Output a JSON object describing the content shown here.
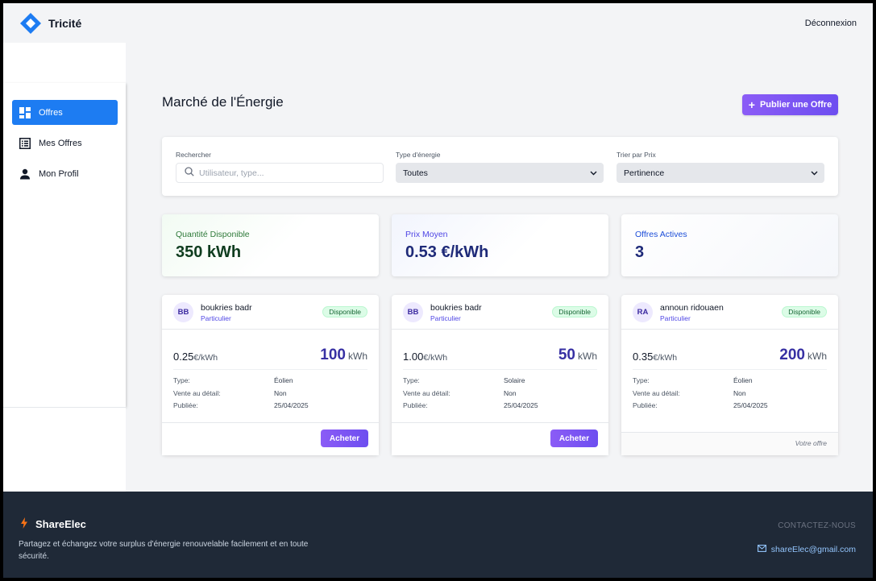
{
  "header": {
    "brand": "Tricité",
    "logout_label": "Déconnexion"
  },
  "sidebar": {
    "items": [
      {
        "label": "Offres",
        "icon": "dashboard-icon",
        "active": true
      },
      {
        "label": "Mes Offres",
        "icon": "list-icon",
        "active": false
      },
      {
        "label": "Mon Profil",
        "icon": "user-icon",
        "active": false
      }
    ]
  },
  "main": {
    "title": "Marché de l'Énergie",
    "publish_label": "Publier une Offre",
    "filters": {
      "search_label": "Rechercher",
      "search_placeholder": "Utilisateur, type...",
      "energy_label": "Type d'énergie",
      "energy_value": "Toutes",
      "sort_label": "Trier par Prix",
      "sort_value": "Pertinence"
    },
    "stats": [
      {
        "label": "Quantité Disponible",
        "value": "350 kWh"
      },
      {
        "label": "Prix Moyen",
        "value": "0.53 €/kWh"
      },
      {
        "label": "Offres Actives",
        "value": "3"
      }
    ],
    "offers": [
      {
        "initials": "BB",
        "name": "boukries badr",
        "seller_type": "Particulier",
        "status": "Disponible",
        "price": "0.25",
        "price_unit": "€/kWh",
        "quantity": "100",
        "quantity_unit": "kWh",
        "type_key": "Type:",
        "type_val": "Éolien",
        "retail_key": "Vente au détail:",
        "retail_val": "Non",
        "published_key": "Publiée:",
        "published_val": "25/04/2025",
        "action": "Acheter"
      },
      {
        "initials": "BB",
        "name": "boukries badr",
        "seller_type": "Particulier",
        "status": "Disponible",
        "price": "1.00",
        "price_unit": "€/kWh",
        "quantity": "50",
        "quantity_unit": "kWh",
        "type_key": "Type:",
        "type_val": "Solaire",
        "retail_key": "Vente au détail:",
        "retail_val": "Non",
        "published_key": "Publiée:",
        "published_val": "25/04/2025",
        "action": "Acheter"
      },
      {
        "initials": "RA",
        "name": "announ ridouaen",
        "seller_type": "Particulier",
        "status": "Disponible",
        "price": "0.35",
        "price_unit": "€/kWh",
        "quantity": "200",
        "quantity_unit": "kWh",
        "type_key": "Type:",
        "type_val": "Éolien",
        "retail_key": "Vente au détail:",
        "retail_val": "Non",
        "published_key": "Publiée:",
        "published_val": "25/04/2025",
        "own_label": "Votre offre"
      }
    ]
  },
  "footer": {
    "brand": "ShareElec",
    "description": "Partagez et échangez votre surplus d'énergie renouvelable facilement et en toute sécurité.",
    "contact_title": "CONTACTEZ-NOUS",
    "email": "shareElec@gmail.com"
  },
  "colors": {
    "accent_blue": "#1d7cf2",
    "accent_purple": "#7c5cf4",
    "footer_bg": "#1f2937"
  }
}
